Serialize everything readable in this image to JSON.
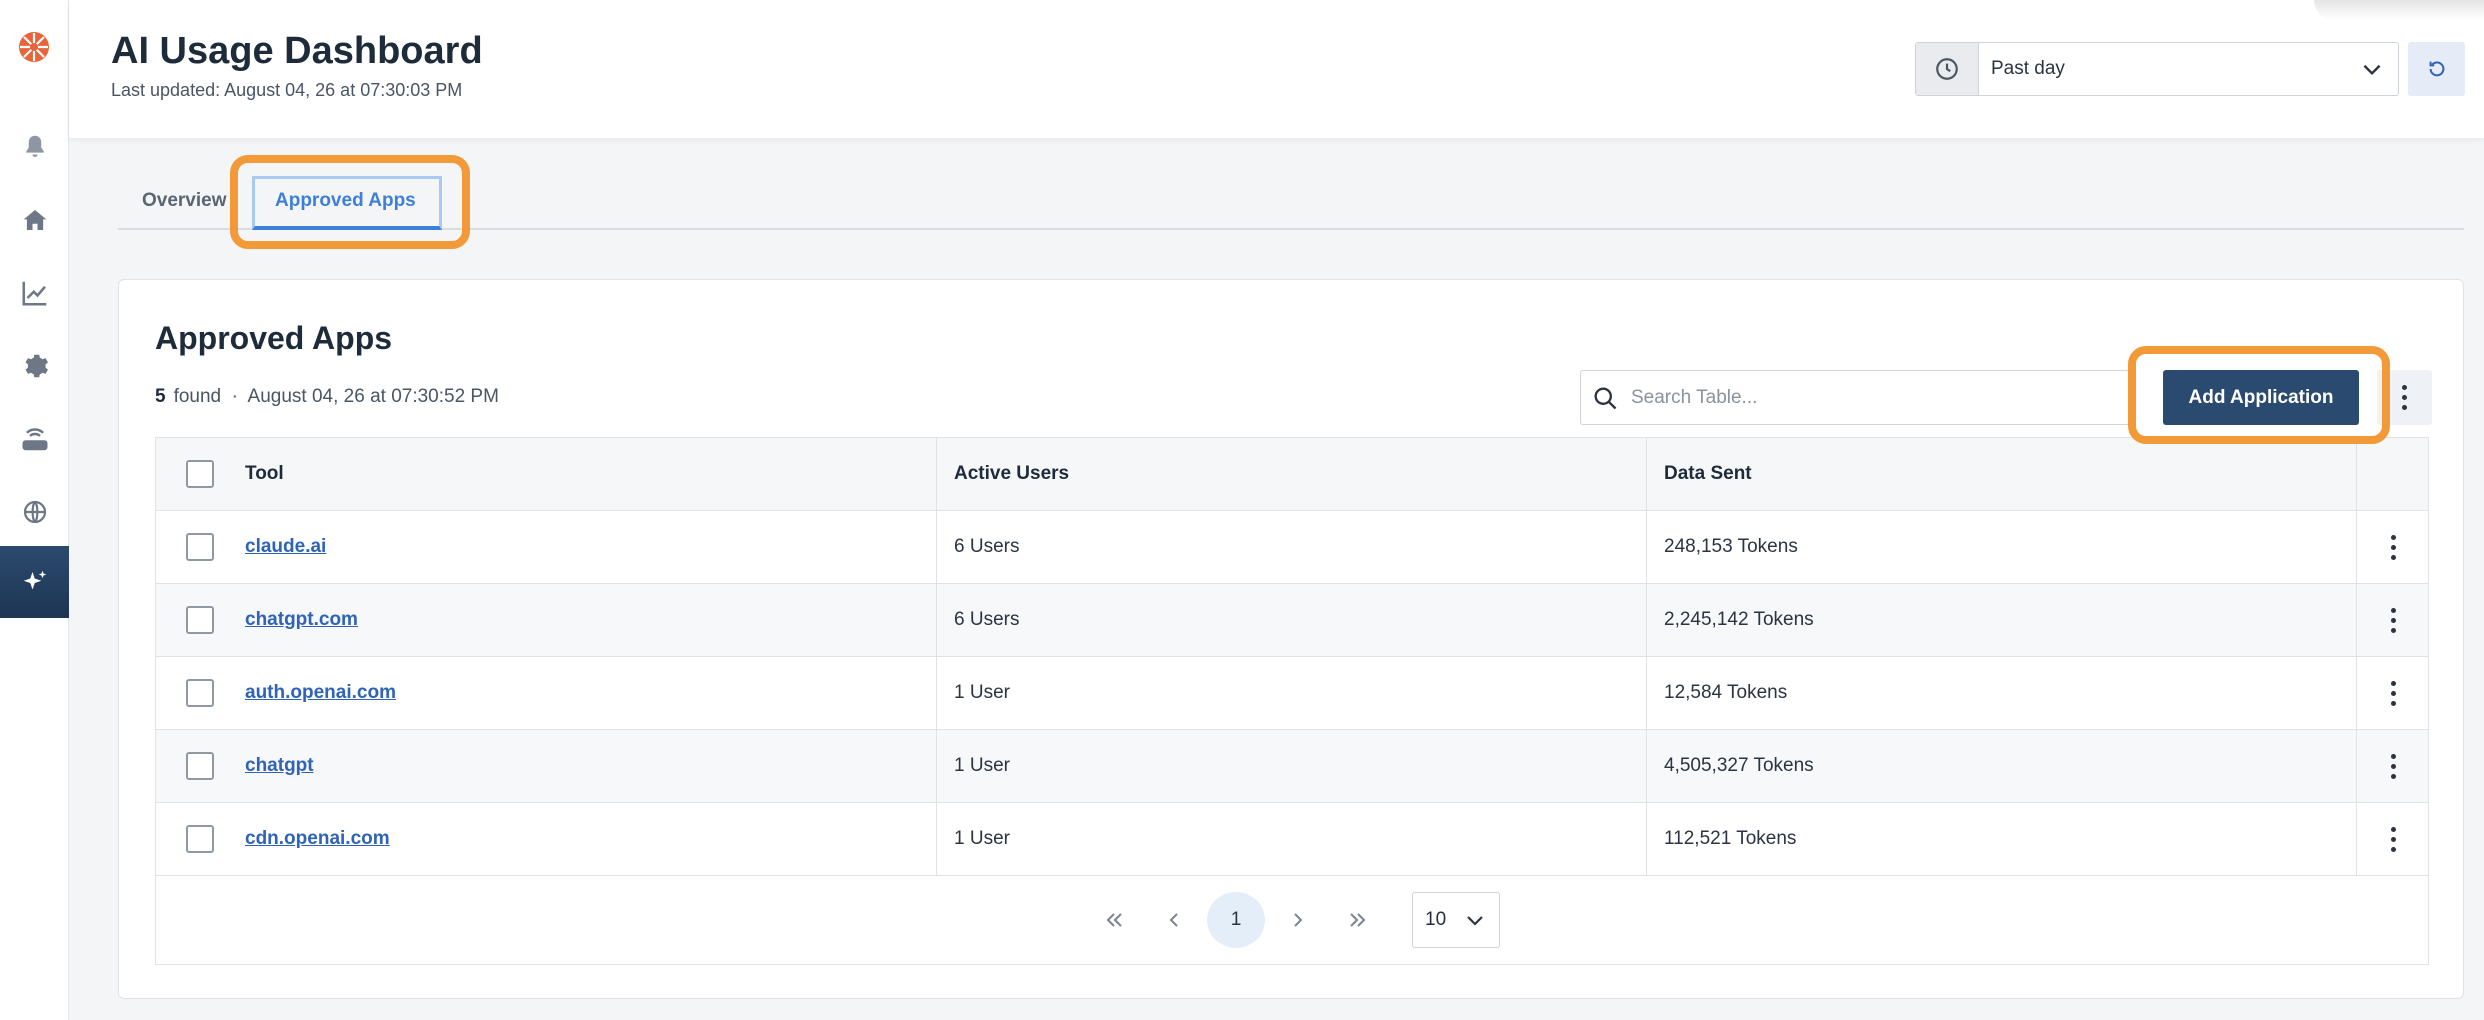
{
  "header": {
    "title": "AI Usage Dashboard",
    "last_updated": "Last updated: August 04, 26 at 07:30:03 PM",
    "time_range": "Past day"
  },
  "sidebar": {
    "items": [
      {
        "icon": "bell-icon"
      },
      {
        "icon": "home-icon"
      },
      {
        "icon": "chart-line-icon"
      },
      {
        "icon": "gear-icon"
      },
      {
        "icon": "router-icon"
      },
      {
        "icon": "globe-icon"
      },
      {
        "icon": "sparkle-icon",
        "active": true
      }
    ]
  },
  "tabs": [
    {
      "label": "Overview"
    },
    {
      "label": "Approved Apps",
      "active": true
    }
  ],
  "card": {
    "title": "Approved Apps",
    "count": "5",
    "found_label": "found",
    "timestamp": "August 04, 26 at 07:30:52 PM",
    "search_placeholder": "Search Table...",
    "add_button": "Add Application"
  },
  "table": {
    "columns": [
      "Tool",
      "Active Users",
      "Data Sent"
    ],
    "rows": [
      {
        "tool": "claude.ai",
        "users": "6 Users",
        "data": "248,153 Tokens"
      },
      {
        "tool": "chatgpt.com",
        "users": "6 Users",
        "data": "2,245,142 Tokens"
      },
      {
        "tool": "auth.openai.com",
        "users": "1 User",
        "data": "12,584 Tokens"
      },
      {
        "tool": "chatgpt",
        "users": "1 User",
        "data": "4,505,327 Tokens"
      },
      {
        "tool": "cdn.openai.com",
        "users": "1 User",
        "data": "112,521 Tokens"
      }
    ]
  },
  "pagination": {
    "current_page": "1",
    "page_size": "10"
  },
  "colors": {
    "accent": "#3f7fd8",
    "primary_button": "#2a4a70",
    "highlight": "#f29a38",
    "logo": "#e8643a"
  }
}
